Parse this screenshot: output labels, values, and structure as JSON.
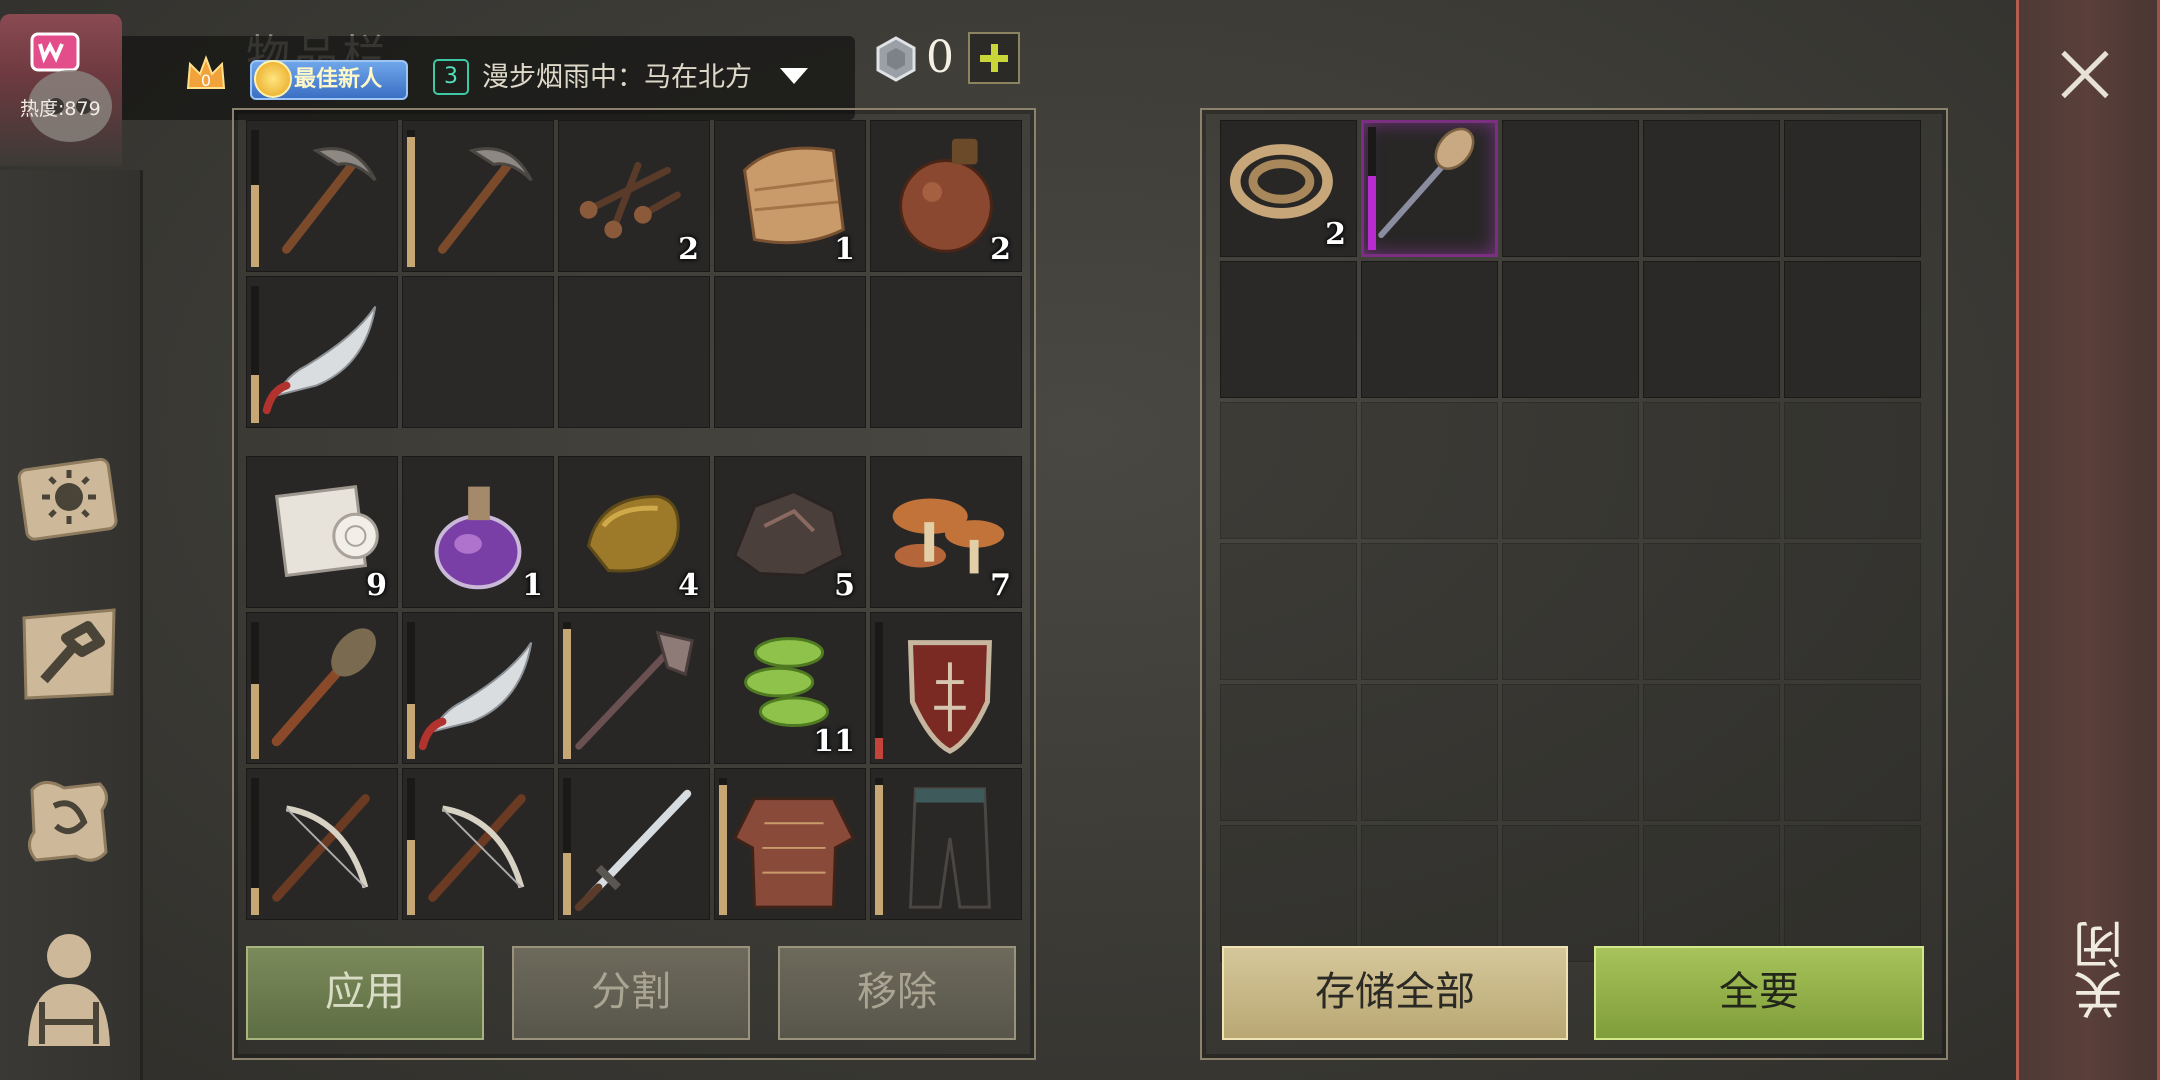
{
  "header": {
    "heat_label": "热度:879",
    "badge_label": "最佳新人",
    "crown_count": "0",
    "channel_num": "3",
    "channel_text": "漫步烟雨中：马在北方",
    "title_partial": "物品栏",
    "coin_value": "0"
  },
  "sidebar": {
    "items": [
      {
        "icon": "journal-sun-icon"
      },
      {
        "icon": "crafting-hammer-icon"
      },
      {
        "icon": "scroll-quest-icon"
      },
      {
        "icon": "character-equipment-icon"
      }
    ]
  },
  "inventory_top": [
    {
      "item": "pickaxe",
      "durability": 0.6
    },
    {
      "item": "pickaxe",
      "durability": 0.95
    },
    {
      "item": "nails",
      "count": "2"
    },
    {
      "item": "cloth",
      "count": "1"
    },
    {
      "item": "water-flask",
      "count": "2"
    },
    {
      "item": "machete",
      "durability": 0.35
    },
    {
      "item": null
    },
    {
      "item": null
    },
    {
      "item": null
    },
    {
      "item": null
    }
  ],
  "inventory_main": [
    {
      "item": "paper-roll",
      "count": "9"
    },
    {
      "item": "purple-potion",
      "count": "1"
    },
    {
      "item": "gold-ingot",
      "count": "4"
    },
    {
      "item": "iron-ore",
      "count": "5"
    },
    {
      "item": "mushrooms",
      "count": "7"
    },
    {
      "item": "club",
      "durability": 0.55
    },
    {
      "item": "machete",
      "durability": 0.4
    },
    {
      "item": "mace",
      "durability": 0.95
    },
    {
      "item": "green-coins",
      "count": "11"
    },
    {
      "item": "shield",
      "durability": 0.15,
      "dura_color": "#c4433a"
    },
    {
      "item": "crossbow",
      "durability": 0.2
    },
    {
      "item": "crossbow",
      "durability": 0.55
    },
    {
      "item": "sword",
      "durability": 0.45
    },
    {
      "item": "chain-shirt",
      "durability": 0.95
    },
    {
      "item": "leather-pants",
      "durability": 0.95
    }
  ],
  "storage": [
    {
      "item": "rope",
      "count": "2"
    },
    {
      "item": "mace-purple",
      "durability": 0.6,
      "dura_color": "#b82bd1",
      "selected": true
    }
  ],
  "buttons": {
    "apply": "应用",
    "split": "分割",
    "remove": "移除",
    "store_all": "存储全部",
    "take_all": "全要"
  },
  "close_label": "关闭",
  "colors": {
    "accent_green": "#7f9d3a",
    "durability": "#c7a773",
    "selected": "#7a2f80"
  }
}
